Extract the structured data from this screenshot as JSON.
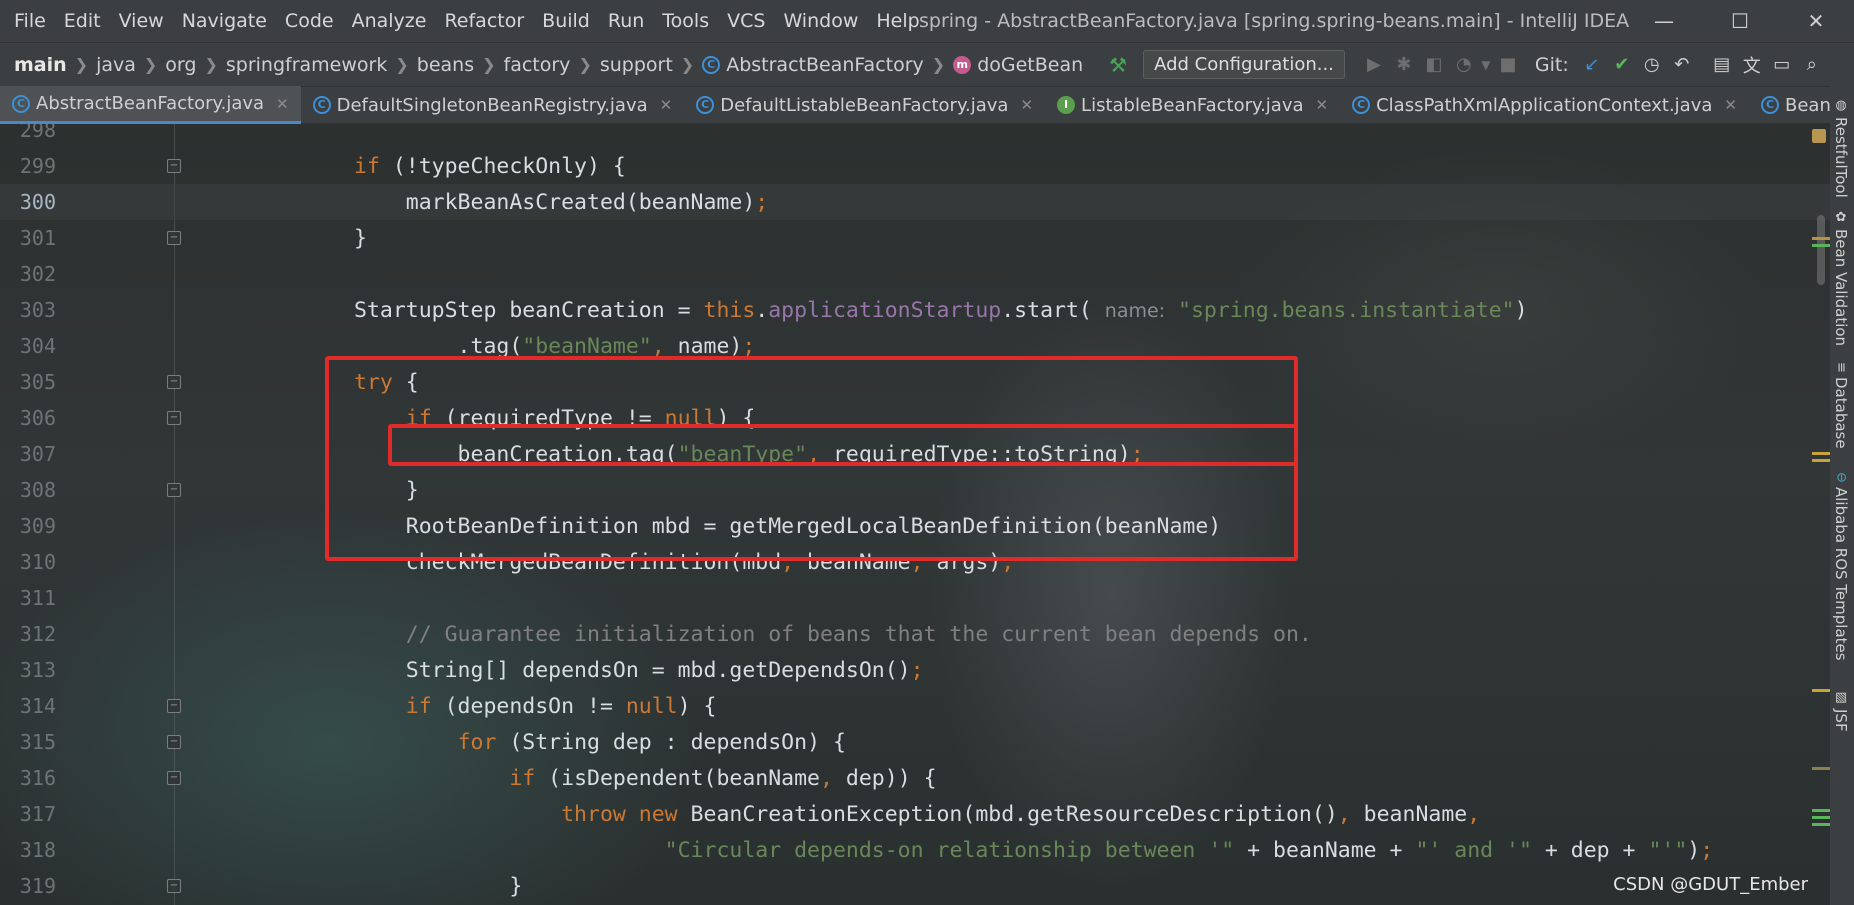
{
  "menu": [
    "File",
    "Edit",
    "View",
    "Navigate",
    "Code",
    "Analyze",
    "Refactor",
    "Build",
    "Run",
    "Tools",
    "VCS",
    "Window",
    "Help"
  ],
  "window_title": "spring - AbstractBeanFactory.java [spring.spring-beans.main] - IntelliJ IDEA",
  "window_controls": {
    "minimize": "—",
    "maximize": "☐",
    "close": "✕"
  },
  "breadcrumbs": [
    "main",
    "java",
    "org",
    "springframework",
    "beans",
    "factory",
    "support",
    "AbstractBeanFactory",
    "doGetBean"
  ],
  "breadcrumb_icons": {
    "class": "C",
    "method": "m"
  },
  "toolbar": {
    "add_config_label": "Add Configuration...",
    "git_label": "Git:"
  },
  "tabs": [
    {
      "label": "AbstractBeanFactory.java",
      "icon": "C",
      "active": true
    },
    {
      "label": "DefaultSingletonBeanRegistry.java",
      "icon": "C",
      "active": false
    },
    {
      "label": "DefaultListableBeanFactory.java",
      "icon": "C",
      "active": false
    },
    {
      "label": "ListableBeanFactory.java",
      "icon": "I",
      "active": false
    },
    {
      "label": "ClassPathXmlApplicationContext.java",
      "icon": "C",
      "active": false
    },
    {
      "label": "BeanF",
      "icon": "C",
      "active": false
    }
  ],
  "editor": {
    "current_line": "300",
    "lines": [
      {
        "n": "298",
        "html": ""
      },
      {
        "n": "299",
        "html": "<span class=\"kw\">if</span> (!typeCheckOnly) {"
      },
      {
        "n": "300",
        "html": "    markBeanAsCreated(beanName)<span class=\"kw\">;</span>"
      },
      {
        "n": "301",
        "html": "}"
      },
      {
        "n": "302",
        "html": ""
      },
      {
        "n": "303",
        "html": "StartupStep beanCreation = <span class=\"kw\">this</span>.<span class=\"fld\">applicationStartup</span>.start( <span class=\"hint\">name:</span> <span class=\"str\">\"spring.beans.instantiate\"</span>)"
      },
      {
        "n": "304",
        "html": "        .tag(<span class=\"str\">\"beanName\"</span><span class=\"kw\">,</span> name)<span class=\"kw\">;</span>"
      },
      {
        "n": "305",
        "html": "<span class=\"kw\">try</span> {"
      },
      {
        "n": "306",
        "html": "    <span class=\"kw\">if</span> (requiredType != <span class=\"kw\">null</span>) {"
      },
      {
        "n": "307",
        "html": "        beanCreation.tag(<span class=\"str\">\"beanType\"</span><span class=\"kw\">,</span> requiredType::toString)<span class=\"kw\">;</span>"
      },
      {
        "n": "308",
        "html": "    }"
      },
      {
        "n": "309",
        "html": "    RootBeanDefinition mbd = getMergedLocalBeanDefinition(beanName)"
      },
      {
        "n": "310",
        "html": "    checkMergedBeanDefinition(mbd<span class=\"kw\">,</span> beanName<span class=\"kw\">,</span> args)<span class=\"kw\">;</span>"
      },
      {
        "n": "311",
        "html": ""
      },
      {
        "n": "312",
        "html": "    <span class=\"cmt\">// Guarantee initialization of beans that the current bean depends on.</span>"
      },
      {
        "n": "313",
        "html": "    String[] dependsOn = mbd.getDependsOn()<span class=\"kw\">;</span>"
      },
      {
        "n": "314",
        "html": "    <span class=\"kw\">if</span> (dependsOn != <span class=\"kw\">null</span>) {"
      },
      {
        "n": "315",
        "html": "        <span class=\"kw\">for</span> (String dep : dependsOn) {"
      },
      {
        "n": "316",
        "html": "            <span class=\"kw\">if</span> (isDependent(beanName<span class=\"kw\">,</span> dep)) {"
      },
      {
        "n": "317",
        "html": "                <span class=\"kw\">throw new</span> BeanCreationException(mbd.getResourceDescription()<span class=\"kw\">,</span> beanName<span class=\"kw\">,</span>"
      },
      {
        "n": "318",
        "html": "                        <span class=\"str\">\"Circular depends-on relationship between '\"</span> + beanName + <span class=\"str\">\"' and '\"</span> + dep + <span class=\"str\">\"'\"</span>)<span class=\"kw\">;</span>"
      },
      {
        "n": "319",
        "html": "            }"
      }
    ]
  },
  "right_panels": [
    "RestfulTool",
    "Bean Validation",
    "Database",
    "Alibaba ROS Templates",
    "JSF"
  ],
  "watermark": "CSDN @GDUT_Ember",
  "colors": {
    "highlight_box": "#e12a2a",
    "keyword": "#cc7832",
    "string": "#6a8759",
    "field": "#9876aa"
  }
}
